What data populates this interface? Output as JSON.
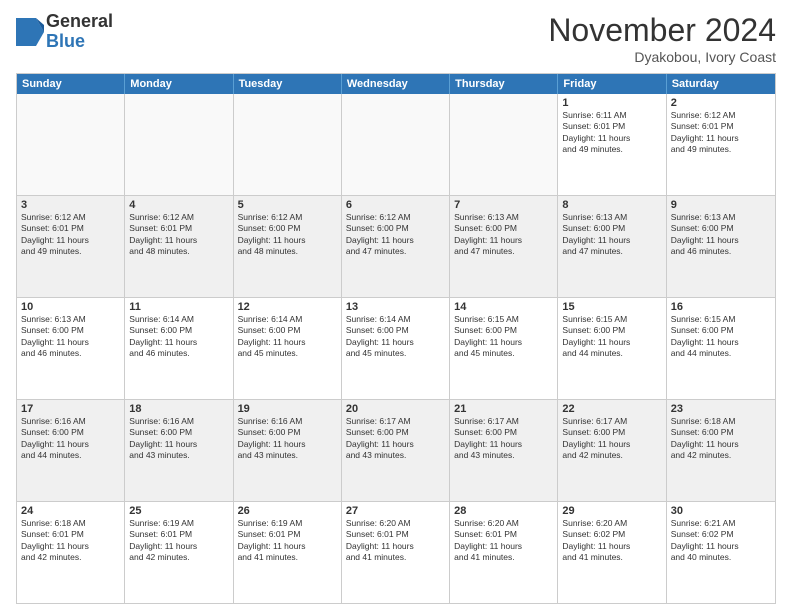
{
  "header": {
    "logo_general": "General",
    "logo_blue": "Blue",
    "month_title": "November 2024",
    "subtitle": "Dyakobou, Ivory Coast"
  },
  "weekdays": [
    "Sunday",
    "Monday",
    "Tuesday",
    "Wednesday",
    "Thursday",
    "Friday",
    "Saturday"
  ],
  "rows": [
    [
      {
        "day": "",
        "lines": [],
        "empty": true
      },
      {
        "day": "",
        "lines": [],
        "empty": true
      },
      {
        "day": "",
        "lines": [],
        "empty": true
      },
      {
        "day": "",
        "lines": [],
        "empty": true
      },
      {
        "day": "",
        "lines": [],
        "empty": true
      },
      {
        "day": "1",
        "lines": [
          "Sunrise: 6:11 AM",
          "Sunset: 6:01 PM",
          "Daylight: 11 hours",
          "and 49 minutes."
        ],
        "empty": false
      },
      {
        "day": "2",
        "lines": [
          "Sunrise: 6:12 AM",
          "Sunset: 6:01 PM",
          "Daylight: 11 hours",
          "and 49 minutes."
        ],
        "empty": false
      }
    ],
    [
      {
        "day": "3",
        "lines": [
          "Sunrise: 6:12 AM",
          "Sunset: 6:01 PM",
          "Daylight: 11 hours",
          "and 49 minutes."
        ],
        "empty": false
      },
      {
        "day": "4",
        "lines": [
          "Sunrise: 6:12 AM",
          "Sunset: 6:01 PM",
          "Daylight: 11 hours",
          "and 48 minutes."
        ],
        "empty": false
      },
      {
        "day": "5",
        "lines": [
          "Sunrise: 6:12 AM",
          "Sunset: 6:00 PM",
          "Daylight: 11 hours",
          "and 48 minutes."
        ],
        "empty": false
      },
      {
        "day": "6",
        "lines": [
          "Sunrise: 6:12 AM",
          "Sunset: 6:00 PM",
          "Daylight: 11 hours",
          "and 47 minutes."
        ],
        "empty": false
      },
      {
        "day": "7",
        "lines": [
          "Sunrise: 6:13 AM",
          "Sunset: 6:00 PM",
          "Daylight: 11 hours",
          "and 47 minutes."
        ],
        "empty": false
      },
      {
        "day": "8",
        "lines": [
          "Sunrise: 6:13 AM",
          "Sunset: 6:00 PM",
          "Daylight: 11 hours",
          "and 47 minutes."
        ],
        "empty": false
      },
      {
        "day": "9",
        "lines": [
          "Sunrise: 6:13 AM",
          "Sunset: 6:00 PM",
          "Daylight: 11 hours",
          "and 46 minutes."
        ],
        "empty": false
      }
    ],
    [
      {
        "day": "10",
        "lines": [
          "Sunrise: 6:13 AM",
          "Sunset: 6:00 PM",
          "Daylight: 11 hours",
          "and 46 minutes."
        ],
        "empty": false
      },
      {
        "day": "11",
        "lines": [
          "Sunrise: 6:14 AM",
          "Sunset: 6:00 PM",
          "Daylight: 11 hours",
          "and 46 minutes."
        ],
        "empty": false
      },
      {
        "day": "12",
        "lines": [
          "Sunrise: 6:14 AM",
          "Sunset: 6:00 PM",
          "Daylight: 11 hours",
          "and 45 minutes."
        ],
        "empty": false
      },
      {
        "day": "13",
        "lines": [
          "Sunrise: 6:14 AM",
          "Sunset: 6:00 PM",
          "Daylight: 11 hours",
          "and 45 minutes."
        ],
        "empty": false
      },
      {
        "day": "14",
        "lines": [
          "Sunrise: 6:15 AM",
          "Sunset: 6:00 PM",
          "Daylight: 11 hours",
          "and 45 minutes."
        ],
        "empty": false
      },
      {
        "day": "15",
        "lines": [
          "Sunrise: 6:15 AM",
          "Sunset: 6:00 PM",
          "Daylight: 11 hours",
          "and 44 minutes."
        ],
        "empty": false
      },
      {
        "day": "16",
        "lines": [
          "Sunrise: 6:15 AM",
          "Sunset: 6:00 PM",
          "Daylight: 11 hours",
          "and 44 minutes."
        ],
        "empty": false
      }
    ],
    [
      {
        "day": "17",
        "lines": [
          "Sunrise: 6:16 AM",
          "Sunset: 6:00 PM",
          "Daylight: 11 hours",
          "and 44 minutes."
        ],
        "empty": false
      },
      {
        "day": "18",
        "lines": [
          "Sunrise: 6:16 AM",
          "Sunset: 6:00 PM",
          "Daylight: 11 hours",
          "and 43 minutes."
        ],
        "empty": false
      },
      {
        "day": "19",
        "lines": [
          "Sunrise: 6:16 AM",
          "Sunset: 6:00 PM",
          "Daylight: 11 hours",
          "and 43 minutes."
        ],
        "empty": false
      },
      {
        "day": "20",
        "lines": [
          "Sunrise: 6:17 AM",
          "Sunset: 6:00 PM",
          "Daylight: 11 hours",
          "and 43 minutes."
        ],
        "empty": false
      },
      {
        "day": "21",
        "lines": [
          "Sunrise: 6:17 AM",
          "Sunset: 6:00 PM",
          "Daylight: 11 hours",
          "and 43 minutes."
        ],
        "empty": false
      },
      {
        "day": "22",
        "lines": [
          "Sunrise: 6:17 AM",
          "Sunset: 6:00 PM",
          "Daylight: 11 hours",
          "and 42 minutes."
        ],
        "empty": false
      },
      {
        "day": "23",
        "lines": [
          "Sunrise: 6:18 AM",
          "Sunset: 6:00 PM",
          "Daylight: 11 hours",
          "and 42 minutes."
        ],
        "empty": false
      }
    ],
    [
      {
        "day": "24",
        "lines": [
          "Sunrise: 6:18 AM",
          "Sunset: 6:01 PM",
          "Daylight: 11 hours",
          "and 42 minutes."
        ],
        "empty": false
      },
      {
        "day": "25",
        "lines": [
          "Sunrise: 6:19 AM",
          "Sunset: 6:01 PM",
          "Daylight: 11 hours",
          "and 42 minutes."
        ],
        "empty": false
      },
      {
        "day": "26",
        "lines": [
          "Sunrise: 6:19 AM",
          "Sunset: 6:01 PM",
          "Daylight: 11 hours",
          "and 41 minutes."
        ],
        "empty": false
      },
      {
        "day": "27",
        "lines": [
          "Sunrise: 6:20 AM",
          "Sunset: 6:01 PM",
          "Daylight: 11 hours",
          "and 41 minutes."
        ],
        "empty": false
      },
      {
        "day": "28",
        "lines": [
          "Sunrise: 6:20 AM",
          "Sunset: 6:01 PM",
          "Daylight: 11 hours",
          "and 41 minutes."
        ],
        "empty": false
      },
      {
        "day": "29",
        "lines": [
          "Sunrise: 6:20 AM",
          "Sunset: 6:02 PM",
          "Daylight: 11 hours",
          "and 41 minutes."
        ],
        "empty": false
      },
      {
        "day": "30",
        "lines": [
          "Sunrise: 6:21 AM",
          "Sunset: 6:02 PM",
          "Daylight: 11 hours",
          "and 40 minutes."
        ],
        "empty": false
      }
    ]
  ]
}
